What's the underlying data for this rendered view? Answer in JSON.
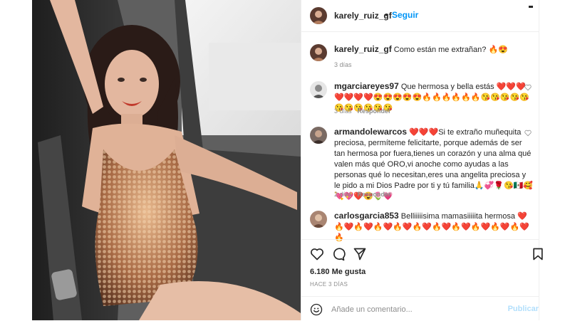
{
  "post": {
    "image_alt": "",
    "author": {
      "username": "karely_ruiz_gf",
      "follow_label": "Seguir",
      "separator": "•"
    }
  },
  "caption": {
    "username": "karely_ruiz_gf",
    "text": "Como están me extrañan? 🔥😍",
    "time": "3 días"
  },
  "comments": [
    {
      "username": "mgarciareyes97",
      "text": "Que hermosa y bella estás ❤️❤️❤️❤️❤️❤️❤️😍😍😍😍😍🔥🔥🔥🔥🔥🔥😘😘😘😘😘😘😘😘😘😘😘",
      "time": "3 días",
      "reply_label": "Responder"
    },
    {
      "username": "armandolewarcos",
      "text": "❤️❤️❤️Si te extraño muñequita preciosa, permíteme felicitarte, porque además de ser tan hermosa por fuera,tienes un corazón y una alma qué valen más qué ORO,vi anoche como ayudas a las personas qué lo necesitan,eres una angelita preciosa y le pido a mi Dios Padre por ti y tú familia🙏💞🌹😘🇲🇽🥰💘💖❤️😍🌷💗",
      "time": "2 días",
      "reply_label": "Responder"
    },
    {
      "username": "carlosgarcia853",
      "text": "Belliiiiisima mamasiiiiita hermosa ❤️🔥❤️🔥❤️🔥❤️🔥❤️🔥❤️🔥❤️🔥❤️🔥❤️🔥❤️🔥❤️🔥",
      "time": "",
      "reply_label": ""
    }
  ],
  "actions": {
    "likes": "6.180 Me gusta",
    "time_ago": "HACE 3 DÍAS"
  },
  "add_comment": {
    "placeholder": "Añade un comentario...",
    "publish_label": "Publicar"
  },
  "colors": {
    "accent": "#0095f6",
    "publish_disabled": "#b2dffc",
    "heart_red": "#ed4956",
    "muted": "#8e8e8e"
  },
  "icons": [
    "more-icon",
    "heart-icon",
    "comment-icon",
    "share-icon",
    "bookmark-icon",
    "emoji-icon"
  ]
}
